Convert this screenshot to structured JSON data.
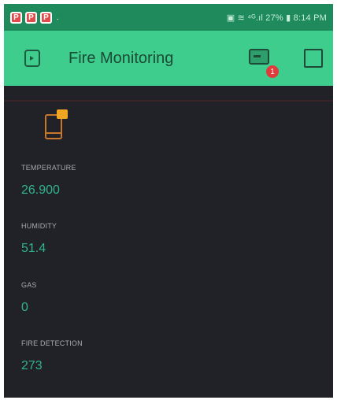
{
  "status_bar": {
    "left_icons": [
      "P",
      "P",
      "P"
    ],
    "right_text": "▣ ≋ ⁴ᴳ.ıl 27% ▮ 8:14 PM"
  },
  "app_bar": {
    "title": "Fire Monitoring",
    "notification_count": "1"
  },
  "widgets": [
    {
      "label": "TEMPERATURE",
      "value": "26.900"
    },
    {
      "label": "HUMIDITY",
      "value": "51.4"
    },
    {
      "label": "GAS",
      "value": "0"
    },
    {
      "label": "FIRE DETECTION",
      "value": "273"
    }
  ],
  "colors": {
    "status_bar": "#1f8a5b",
    "app_bar": "#3ecd8d",
    "background": "#212227",
    "value_text": "#30b488",
    "label_text": "#a8a9ae",
    "device_icon": "#c9772b",
    "notification_badge": "#e03a3a"
  },
  "icons": {
    "back": "back-to-device-icon",
    "device": "device-switch-icon",
    "stop": "stop-square-icon",
    "widget": "device-widget-icon"
  }
}
